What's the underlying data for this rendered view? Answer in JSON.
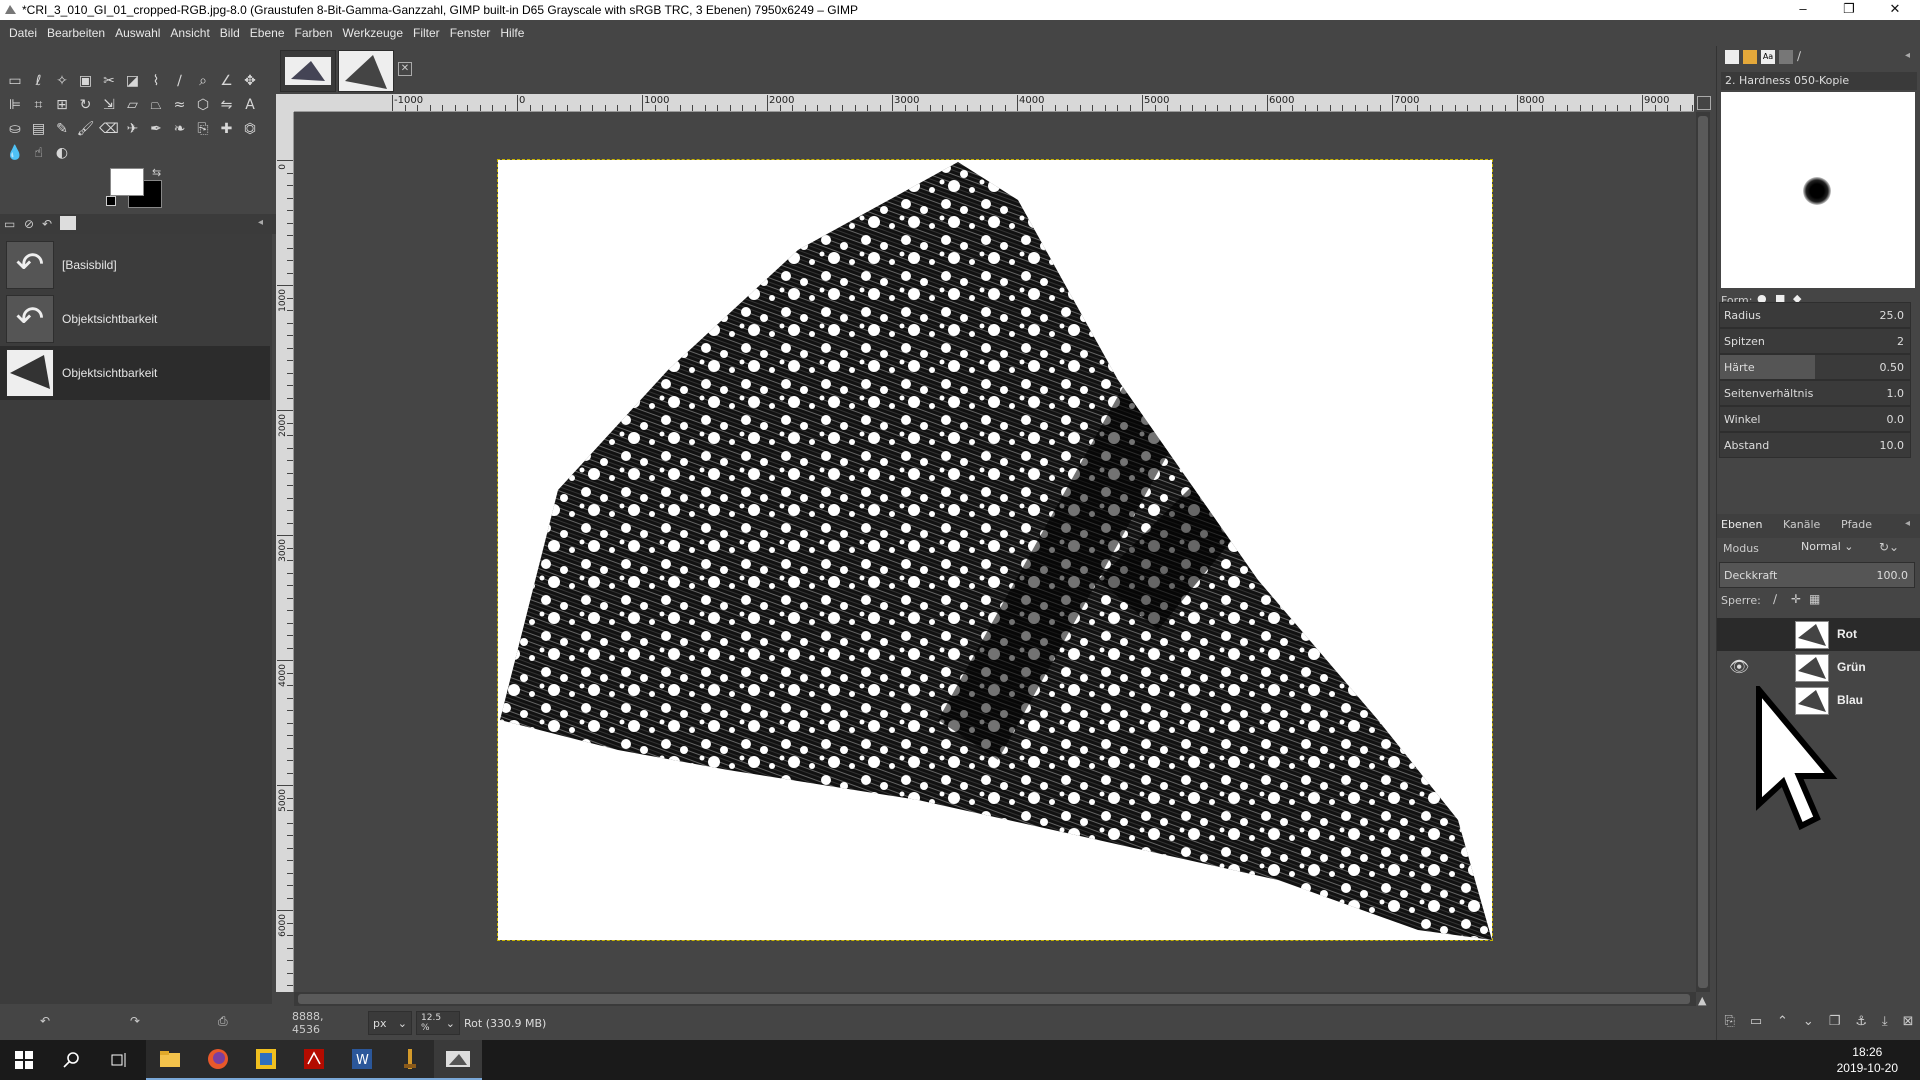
{
  "window": {
    "title": "*CRI_3_010_GI_01_cropped-RGB.jpg-8.0 (Graustufen 8-Bit-Gamma-Ganzzahl, GIMP built-in D65 Grayscale with sRGB TRC, 3 Ebenen) 7950x6249 – GIMP",
    "minimize": "–",
    "maximize": "❐",
    "close": "✕"
  },
  "menu": [
    "Datei",
    "Bearbeiten",
    "Auswahl",
    "Ansicht",
    "Bild",
    "Ebene",
    "Farben",
    "Werkzeuge",
    "Filter",
    "Fenster",
    "Hilfe"
  ],
  "tools": [
    "rect-select-icon",
    "lasso-icon",
    "fuzzy-select-icon",
    "by-color-select-icon",
    "scissors-icon",
    "foreground-select-icon",
    "paths-icon",
    "color-picker-icon",
    "zoom-icon",
    "measure-icon",
    "move-icon",
    "align-icon",
    "crop-icon",
    "unified-transform-icon",
    "rotate-icon",
    "scale-icon",
    "shear-icon",
    "perspective-icon",
    "warp-icon",
    "cage-icon",
    "flip-icon",
    "text-icon",
    "bucket-fill-icon",
    "gradient-icon",
    "pencil-icon",
    "paintbrush-icon",
    "eraser-icon",
    "airbrush-icon",
    "ink-icon",
    "mypaint-icon",
    "clone-icon",
    "heal-icon",
    "perspective-clone-icon",
    "blur-icon",
    "smudge-icon",
    "dodge-burn-icon"
  ],
  "history": {
    "items": [
      {
        "label": "[Basisbild]",
        "icon": "undo-icon",
        "selected": false
      },
      {
        "label": "Objektsichtbarkeit",
        "icon": "undo-icon",
        "selected": false
      },
      {
        "label": "Objektsichtbarkeit",
        "icon": "layer-thumb",
        "selected": true
      }
    ],
    "footer": [
      "undo-icon",
      "redo-icon",
      "clear-history-icon"
    ]
  },
  "ruler": {
    "h_labels": [
      "-1000",
      "0",
      "1000",
      "2000",
      "3000",
      "4000",
      "5000",
      "6000",
      "7000",
      "8000",
      "9000"
    ],
    "v_labels": [
      "0",
      "1000",
      "2000",
      "3000",
      "4000",
      "5000",
      "6000"
    ]
  },
  "status": {
    "coords": "8888, 4536",
    "unit": "px",
    "zoom": "12.5 %",
    "layer_info": "Rot (330.9 MB)"
  },
  "brushes": {
    "name": "2. Hardness 050-Kopie",
    "form_label": "Form:",
    "sliders": [
      {
        "label": "Radius",
        "value": "25.0",
        "fill": 0.0
      },
      {
        "label": "Spitzen",
        "value": "2",
        "fill": 0.0
      },
      {
        "label": "Härte",
        "value": "0.50",
        "fill": 0.5
      },
      {
        "label": "Seitenverhältnis",
        "value": "1.0",
        "fill": 0.0
      },
      {
        "label": "Winkel",
        "value": "0.0",
        "fill": 0.0
      },
      {
        "label": "Abstand",
        "value": "10.0",
        "fill": 0.0
      }
    ]
  },
  "layers_panel": {
    "tabs": [
      "Ebenen",
      "Kanäle",
      "Pfade"
    ],
    "mode_label": "Modus",
    "mode_value": "Normal",
    "opacity_label": "Deckkraft",
    "opacity_value": "100.0",
    "lock_label": "Sperre:",
    "layers": [
      {
        "name": "Rot",
        "visible": false,
        "selected": true
      },
      {
        "name": "Grün",
        "visible": true,
        "selected": false
      },
      {
        "name": "Blau",
        "visible": false,
        "selected": false
      }
    ]
  },
  "taskbar": {
    "apps": [
      "start-icon",
      "search-icon",
      "task-view-icon",
      "explorer-icon",
      "firefox-icon",
      "app-icon",
      "acrobat-icon",
      "word-icon",
      "app-icon-2",
      "gimp-icon"
    ],
    "time": "18:26",
    "date": "2019-10-20"
  },
  "colors": {
    "accent_yellow": "#c8b400",
    "panel": "#454545"
  }
}
